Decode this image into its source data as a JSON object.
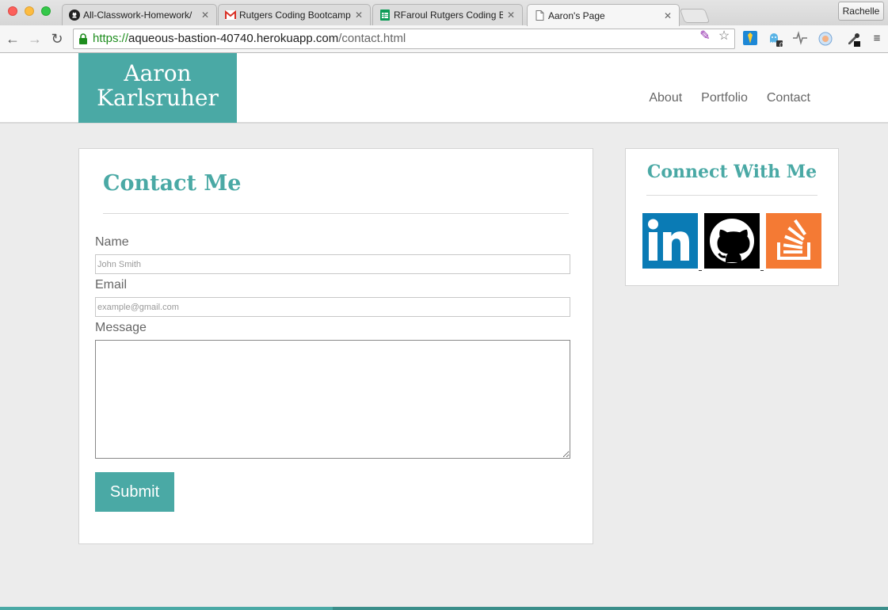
{
  "browser": {
    "tabs": [
      {
        "title": "All-Classwork-Homework/",
        "icon": "github-icon"
      },
      {
        "title": "Rutgers Coding Bootcamp",
        "icon": "gmail-icon"
      },
      {
        "title": "RFaroul Rutgers Coding Bo",
        "icon": "sheets-icon"
      },
      {
        "title": "Aaron's Page",
        "icon": "page-icon",
        "active": true
      }
    ],
    "tab_close_glyph": "✕",
    "profile_name": "Rachelle",
    "url": {
      "scheme": "https://",
      "host": "aqueous-bastion-40740.herokuapp.com",
      "path": "/contact.html"
    },
    "extension_badge": "0"
  },
  "site": {
    "logo_line1": "Aaron",
    "logo_line2": "Karlsruher",
    "nav": [
      "About",
      "Portfolio",
      "Contact"
    ],
    "accent_color": "#4aa9a5"
  },
  "contact_form": {
    "title": "Contact Me",
    "name_label": "Name",
    "name_placeholder": "John Smith",
    "email_label": "Email",
    "email_placeholder": "example@gmail.com",
    "message_label": "Message",
    "submit_label": "Submit"
  },
  "connect": {
    "title": "Connect With Me",
    "links": [
      {
        "name": "linkedin",
        "icon": "linkedin-icon",
        "color": "#0a7bb5"
      },
      {
        "name": "github",
        "icon": "github-icon",
        "color": "#000000"
      },
      {
        "name": "stackoverflow",
        "icon": "stackoverflow-icon",
        "color": "#f48024"
      }
    ]
  }
}
